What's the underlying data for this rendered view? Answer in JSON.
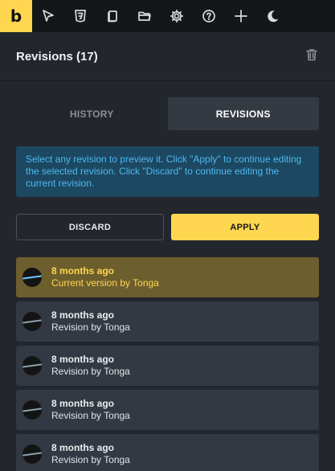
{
  "toolbar": {
    "logo_letter": "b",
    "icons": [
      "cursor-icon",
      "css3-icon",
      "pages-icon",
      "folder-icon",
      "gear-icon",
      "help-icon",
      "plus-icon",
      "moon-icon"
    ]
  },
  "panel": {
    "title": "Revisions (17)"
  },
  "tabs": {
    "history_label": "HISTORY",
    "revisions_label": "REVISIONS",
    "active": "REVISIONS"
  },
  "info": {
    "text": "Select any revision to preview it. Click \"Apply\" to continue editing the selected revision. Click \"Discard\" to continue editing the current revision."
  },
  "actions": {
    "discard_label": "DISCARD",
    "apply_label": "APPLY"
  },
  "revisions": [
    {
      "time": "8 months ago",
      "desc": "Current version by Tonga",
      "current": true
    },
    {
      "time": "8 months ago",
      "desc": "Revision by Tonga",
      "current": false
    },
    {
      "time": "8 months ago",
      "desc": "Revision by Tonga",
      "current": false
    },
    {
      "time": "8 months ago",
      "desc": "Revision by Tonga",
      "current": false
    },
    {
      "time": "8 months ago",
      "desc": "Revision by Tonga",
      "current": false
    }
  ],
  "colors": {
    "accent": "#ffd64f",
    "panel_bg": "#23272d",
    "toolbar_bg": "#14171a",
    "info_bg": "#1c4861",
    "info_text": "#4fb7ef",
    "item_bg": "#333942",
    "current_item_bg": "#6d5e2e"
  }
}
